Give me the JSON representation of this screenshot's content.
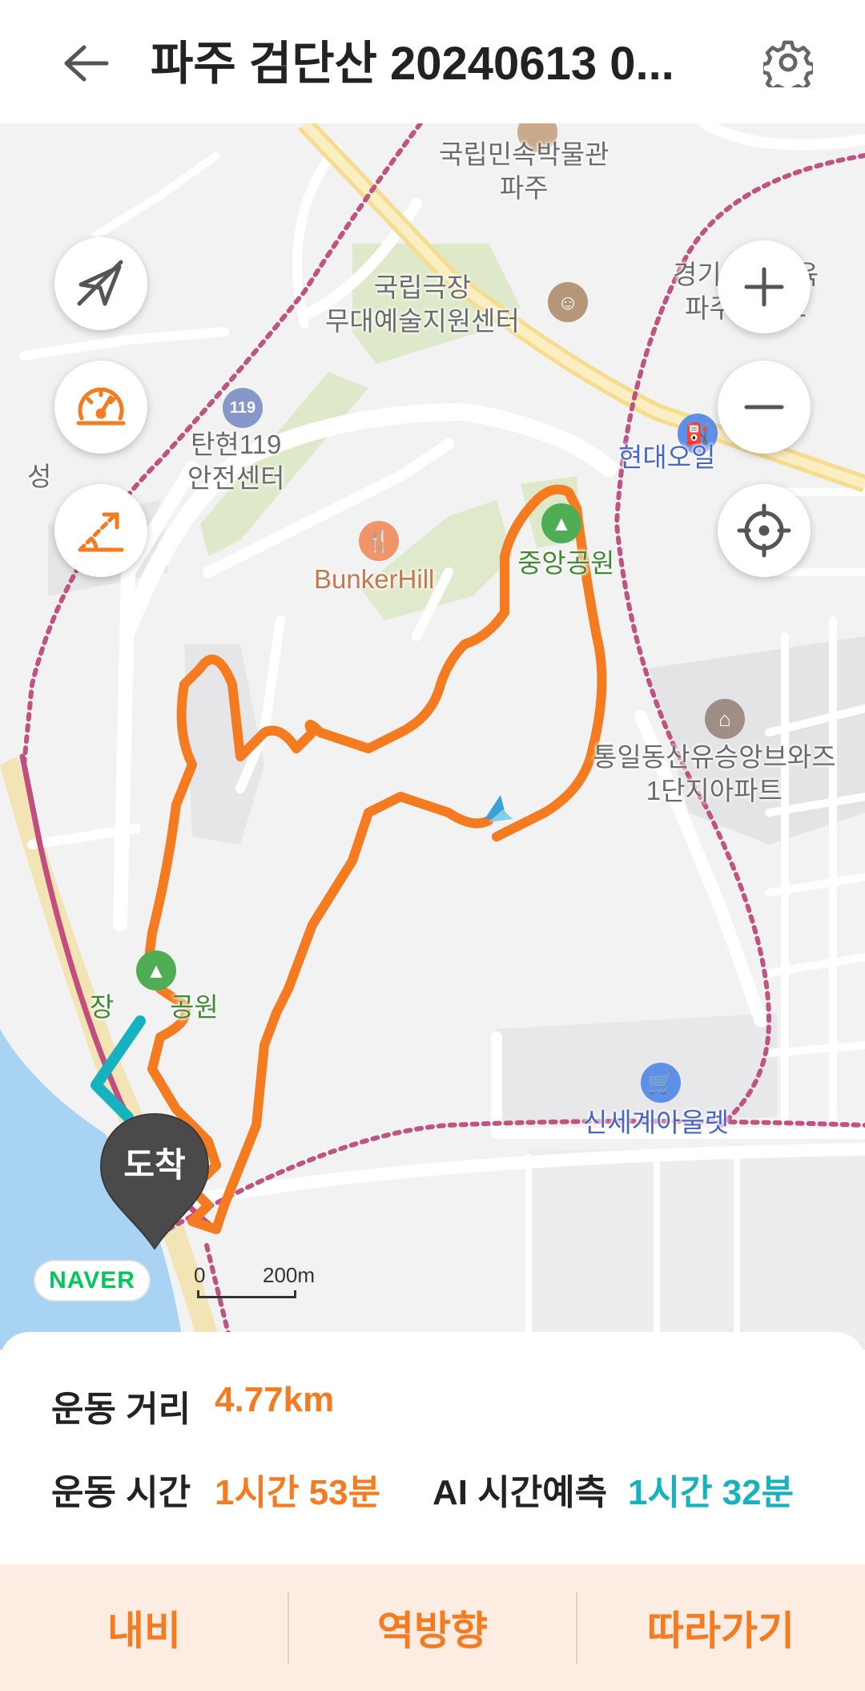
{
  "header": {
    "title": "파주 검단산 20240613 0...",
    "back_icon": "arrow-left-icon",
    "settings_icon": "gear-icon"
  },
  "map": {
    "labels": {
      "museum": "국립민속박물관\n파주",
      "theater": "국립극장\n무대예술지원센터",
      "education": "경기미래교육\n파주캠퍼스",
      "fire_station": "탄현119\n안전센터",
      "hyundai_oil": "현대오일",
      "bunker_hill": "BunkerHill",
      "central_park": "중앙공원",
      "apartment": "통일동산유승앙브와즈\n1단지아파트",
      "jang_park": "장",
      "jang_park_suffix": "공원",
      "outlet": "신세계아울렛",
      "edge_label": "성"
    },
    "arrival_label": "도착",
    "brand_logo": "NAVER",
    "scale": {
      "zero": "0",
      "distance": "200m"
    },
    "controls": {
      "compass_icon": "compass-off-icon",
      "speed_icon": "speedometer-icon",
      "slope_icon": "slope-icon",
      "zoom_in_icon": "plus-icon",
      "zoom_out_icon": "minus-icon",
      "locate_icon": "crosshair-icon"
    },
    "route_color": "#f47b20",
    "ai_color": "#17b2bf"
  },
  "stats": {
    "distance_label": "운동 거리",
    "distance_value": "4.77km",
    "time_label": "운동 시간",
    "time_value": "1시간 53분",
    "ai_label": "AI 시간예측",
    "ai_value": "1시간 32분"
  },
  "actions": {
    "navi": "내비",
    "reverse": "역방향",
    "follow": "따라가기"
  }
}
